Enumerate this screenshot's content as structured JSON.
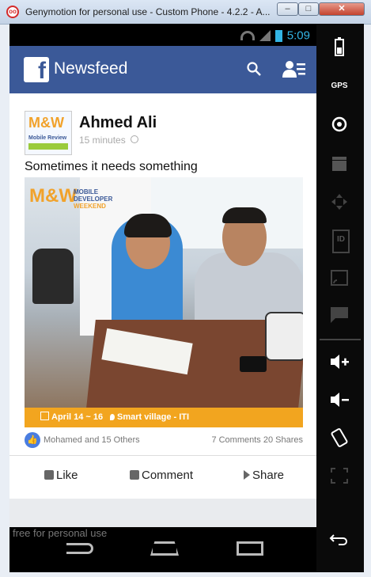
{
  "window": {
    "title": "Genymotion for personal use - Custom Phone - 4.2.2 - A...",
    "app_icon": "oo",
    "min_label": "–",
    "max_label": "□",
    "close_label": "✕"
  },
  "statusbar": {
    "time": "5:09"
  },
  "header": {
    "logo": "f",
    "title": "Newsfeed"
  },
  "post": {
    "author": "Ahmed Ali",
    "time": "15 minutes",
    "text": "Sometimes it needs something",
    "avatar_logo": "M&W",
    "avatar_sub": "Mobile Review",
    "photo_logo": "M&W",
    "photo_logo_line1": "MOBILE",
    "photo_logo_line2": "DEVELOPER",
    "photo_logo_line3": "WEEKEND",
    "banner_date": "April 14 ~ 16",
    "banner_location": "Smart village - ITI",
    "likes_text": "Mohamed and 15 Others",
    "counts_text": "7 Comments  20 Shares",
    "like_icon": "👍"
  },
  "actions": {
    "like": "Like",
    "comment": "Comment",
    "share": "Share"
  },
  "watermark": "free for personal use",
  "sidebar": {
    "gps": "GPS",
    "id": "ID"
  }
}
